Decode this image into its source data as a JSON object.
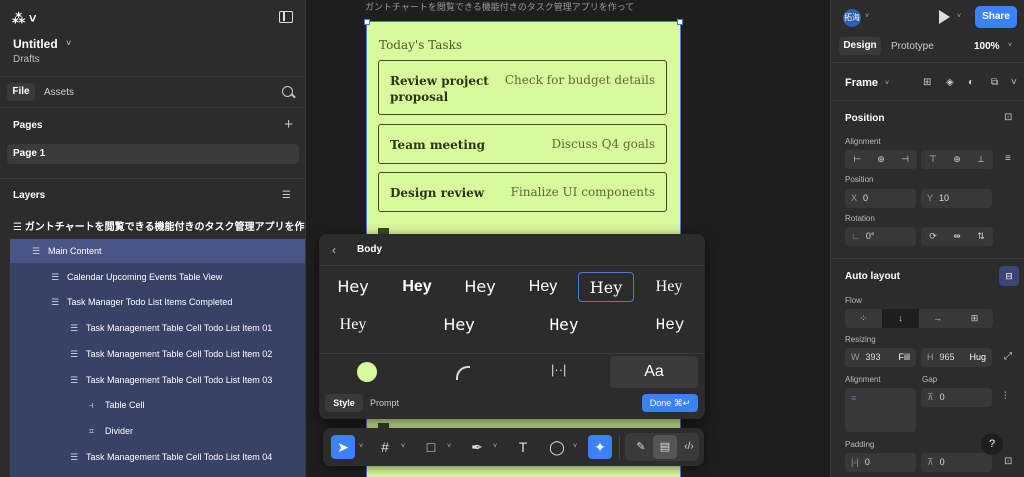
{
  "left": {
    "file_name": "Untitled",
    "location": "Drafts",
    "tabs": [
      "File",
      "Assets"
    ],
    "pages_header": "Pages",
    "page": "Page 1",
    "layers_header": "Layers",
    "root_layer": "ガントチャートを閲覧できる機能付きのタスク管理アプリを作って",
    "layers": [
      {
        "label": "Main Content",
        "indent": 0
      },
      {
        "label": "Calendar Upcoming Events Table View",
        "indent": 1
      },
      {
        "label": "Task Manager Todo List Items Completed",
        "indent": 1
      },
      {
        "label": "Task Management Table Cell Todo List Item 01",
        "indent": 2
      },
      {
        "label": "Task Management Table Cell Todo List Item 02",
        "indent": 2
      },
      {
        "label": "Task Management Table Cell Todo List Item 03",
        "indent": 2
      },
      {
        "label": "Table Cell",
        "indent": 3
      },
      {
        "label": "Divider",
        "indent": 3
      },
      {
        "label": "Task Management Table Cell Todo List Item 04",
        "indent": 2
      }
    ]
  },
  "canvas": {
    "frame_label": "ガントチャートを閲覧できる機能付きのタスク管理アプリを作って",
    "frame_color": "#d9f99d",
    "title": "Today's Tasks",
    "tasks": [
      {
        "title": "Review project\nproposal",
        "detail": "Check for budget details"
      },
      {
        "title": "Team meeting",
        "detail": "Discuss Q4 goals"
      },
      {
        "title": "Design review",
        "detail": "Finalize UI components"
      }
    ]
  },
  "popup": {
    "title": "Body",
    "samples": [
      "Hey",
      "Hey",
      "Hey",
      "Hey",
      "Hey",
      "Hey",
      "Hey",
      "Hey",
      "Hey",
      "Hey"
    ],
    "options_text": "Aa",
    "tabs": [
      "Style",
      "Prompt"
    ],
    "done_label": "Done ⌘↵"
  },
  "right": {
    "avatar": "拓海",
    "share_label": "Share",
    "tabs": [
      "Design",
      "Prototype"
    ],
    "zoom": "100%",
    "frame_label": "Frame",
    "position_header": "Position",
    "alignment_label": "Alignment",
    "position_label": "Position",
    "x_label": "X",
    "x_value": "0",
    "y_label": "Y",
    "y_value": "10",
    "rotation_label": "Rotation",
    "rotation_value": "0°",
    "autolayout_header": "Auto layout",
    "flow_label": "Flow",
    "resizing_label": "Resizing",
    "w_label": "W",
    "w_value": "393",
    "w_mode": "Fill",
    "h_label": "H",
    "h_value": "965",
    "h_mode": "Hug",
    "alignment2_label": "Alignment",
    "gap_label": "Gap",
    "gap_value": "0",
    "padding_label": "Padding",
    "pad_h_value": "0",
    "pad_v_value": "0",
    "help": "?"
  }
}
